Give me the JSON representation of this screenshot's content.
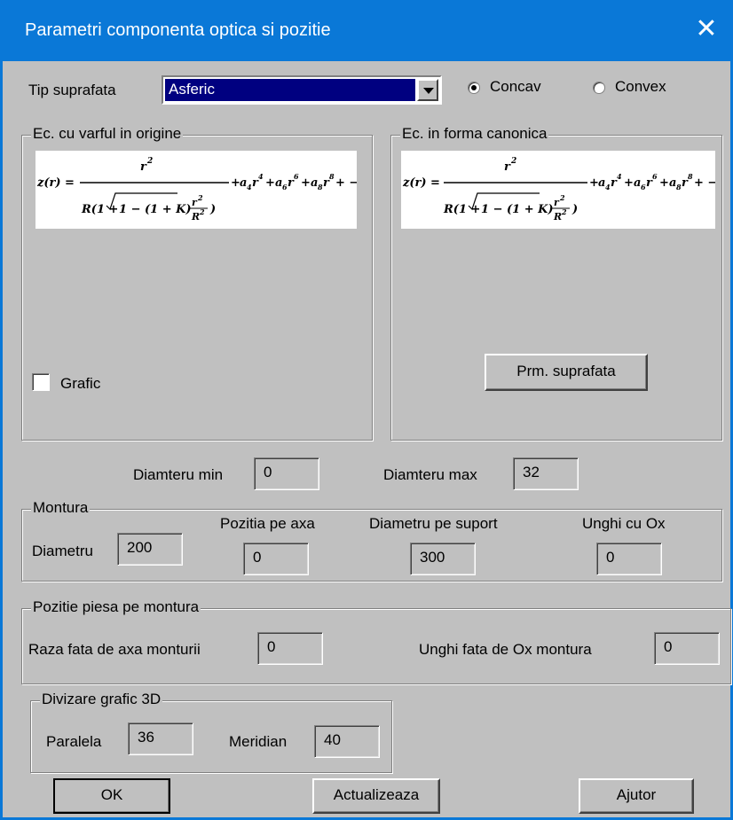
{
  "window": {
    "title": "Parametri componenta optica si pozitie",
    "close_glyph": "✕"
  },
  "surface_type": {
    "label": "Tip suprafata",
    "selected": "Asferic"
  },
  "curvature": {
    "concave_label": "Concav",
    "convex_label": "Convex",
    "selected": "Concav"
  },
  "eq_origin": {
    "legend": "Ec. cu varful in origine",
    "graph_label": "Grafic",
    "graph_checked": false
  },
  "eq_canonical": {
    "legend": "Ec. in forma canonica",
    "button": "Prm. suprafata"
  },
  "formula": {
    "lhs": "z(r) =",
    "numerator": "r",
    "num_exp": "2",
    "denom_prefix": "R(1 + ",
    "denom_root": "1 − (1 + K)",
    "frac_num": "r",
    "frac_num_exp": "2",
    "frac_den": "R",
    "frac_den_exp": "2",
    "denom_suffix": ")",
    "tail_terms": [
      {
        "coef": "a",
        "sub": "4",
        "var": "r",
        "exp": "4"
      },
      {
        "coef": "a",
        "sub": "6",
        "var": "r",
        "exp": "6"
      },
      {
        "coef": "a",
        "sub": "8",
        "var": "r",
        "exp": "8"
      }
    ],
    "tail_end": "+ −"
  },
  "diameter": {
    "min_label": "Diamteru min",
    "min_value": "0",
    "max_label": "Diamteru max",
    "max_value": "32"
  },
  "mount": {
    "legend": "Montura",
    "diameter_label": "Diametru",
    "diameter_value": "200",
    "axis_pos_label": "Pozitia pe axa",
    "axis_pos_value": "0",
    "support_diam_label": "Diametru pe suport",
    "support_diam_value": "300",
    "angle_label": "Unghi cu Ox",
    "angle_value": "0"
  },
  "piece_position": {
    "legend": "Pozitie piesa pe montura",
    "radius_label": "Raza fata de axa monturii",
    "radius_value": "0",
    "angle_label": "Unghi fata de Ox montura",
    "angle_value": "0"
  },
  "graph3d": {
    "legend": "Divizare grafic 3D",
    "parallel_label": "Paralela",
    "parallel_value": "36",
    "meridian_label": "Meridian",
    "meridian_value": "40"
  },
  "buttons": {
    "ok": "OK",
    "update": "Actualizeaza",
    "help": "Ajutor"
  }
}
